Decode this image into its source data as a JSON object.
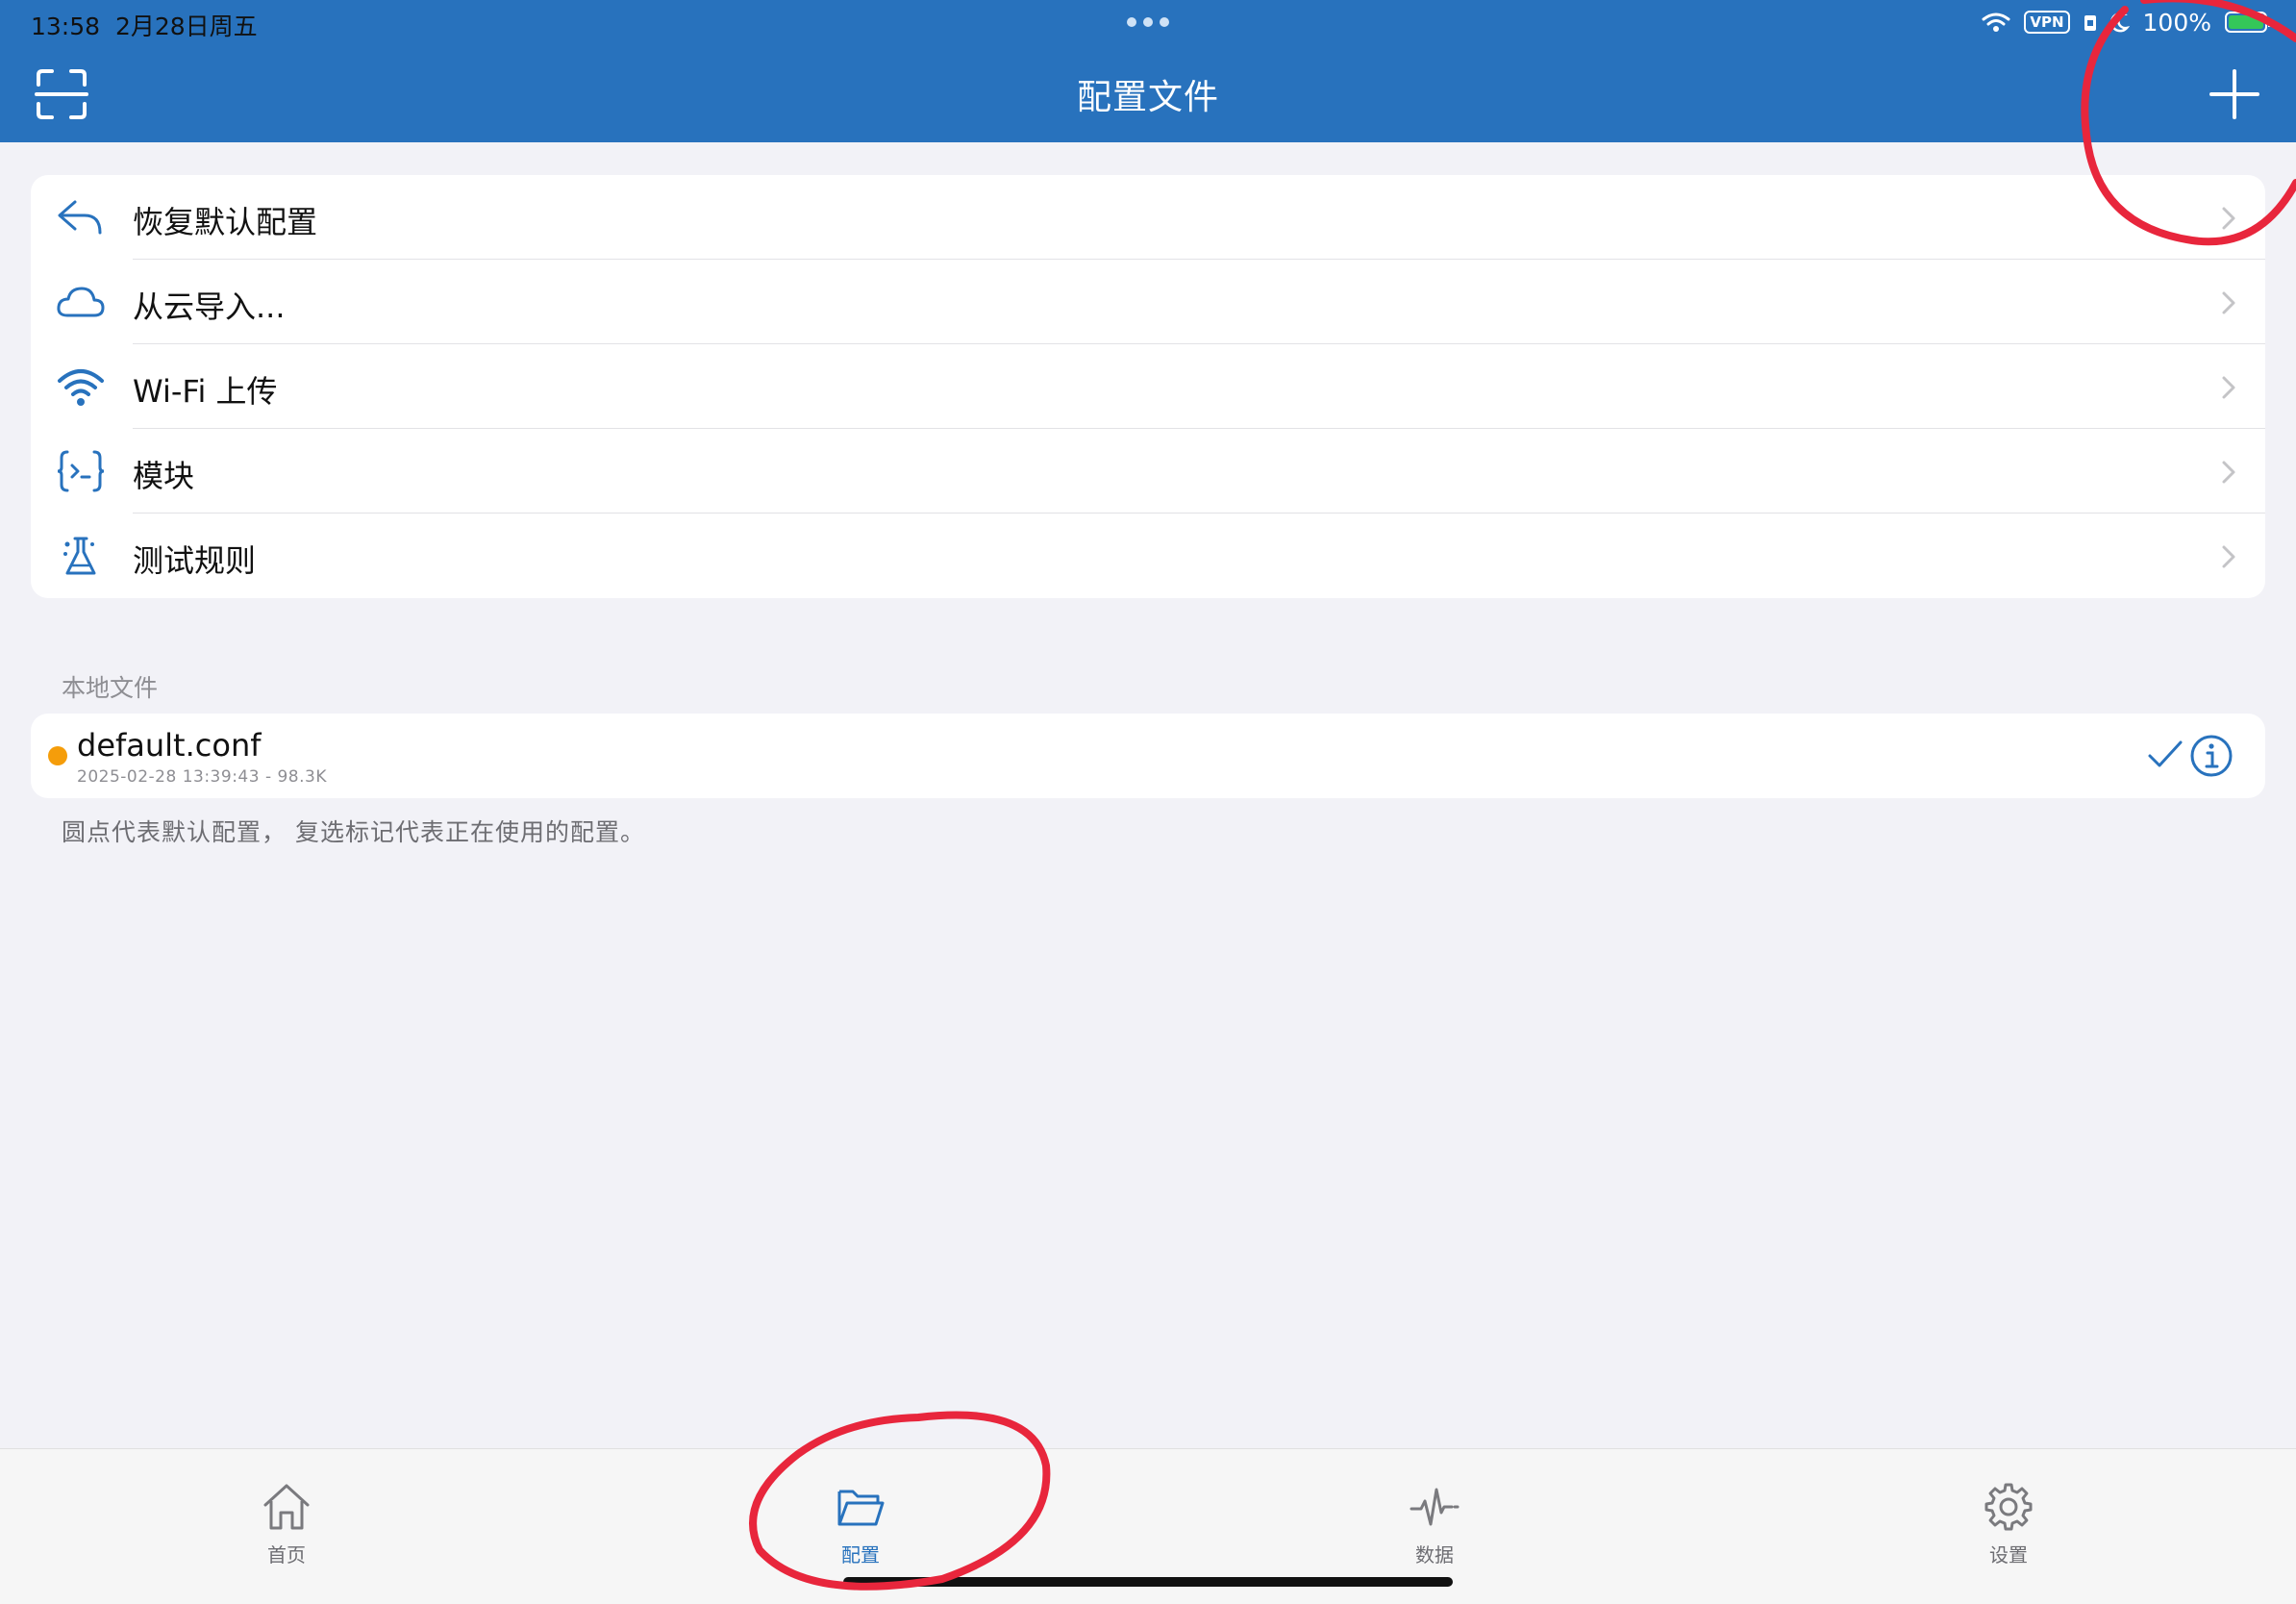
{
  "status_bar": {
    "time": "13:58",
    "date": "2月28日周五",
    "vpn": "VPN",
    "battery": "100%"
  },
  "nav": {
    "title": "配置文件",
    "left_icon": "scan-icon",
    "right_icon": "plus-icon"
  },
  "menu": {
    "items": [
      {
        "icon": "reply-arrow-icon",
        "label": "恢复默认配置"
      },
      {
        "icon": "cloud-icon",
        "label": "从云导入..."
      },
      {
        "icon": "wifi-icon",
        "label": "Wi-Fi 上传"
      },
      {
        "icon": "module-braces-icon",
        "label": "模块"
      },
      {
        "icon": "flask-icon",
        "label": "测试规则"
      }
    ]
  },
  "local_files": {
    "header": "本地文件",
    "files": [
      {
        "name": "default.conf",
        "meta": "2025-02-28 13:39:43 - 98.3K",
        "is_default": true,
        "in_use": true
      }
    ],
    "footnote": "圆点代表默认配置，  复选标记代表正在使用的配置。"
  },
  "tabbar": {
    "tabs": [
      {
        "label": "首页",
        "icon": "home-icon",
        "active": false
      },
      {
        "label": "配置",
        "icon": "folder-icon",
        "active": true
      },
      {
        "label": "数据",
        "icon": "activity-icon",
        "active": false
      },
      {
        "label": "设置",
        "icon": "gear-icon",
        "active": false
      }
    ]
  },
  "colors": {
    "accent": "#2872bd",
    "background": "#f2f2f7",
    "default_dot": "#f59d0a",
    "annotation": "#e8263c"
  }
}
